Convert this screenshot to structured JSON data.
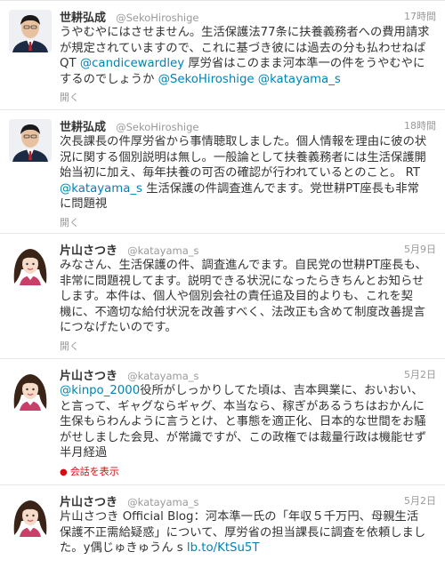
{
  "tweets": [
    {
      "name": "世耕弘成",
      "handle": "@SekoHiroshige",
      "time": "17時間",
      "lines": [
        "うやむやにはさせません。生活保護法77条に扶養義務者への費用請求",
        "が規定されていますので、これに基づき彼には過去の分も払わせねば"
      ],
      "line3": {
        "pre": "QT ",
        "mention1": "@candicewardley",
        "mid": " 厚労省はこのまま河本準一の件をうやむやに"
      },
      "line4": {
        "pre": "するのでしょうか ",
        "mention1": "@SekoHiroshige",
        "sep": " ",
        "mention2": "@katayama_s"
      },
      "action": "開く"
    },
    {
      "name": "世耕弘成",
      "handle": "@SekoHiroshige",
      "time": "18時間",
      "lines": [
        "次長課長の件厚労省から事情聴取しました。個人情報を理由に彼の状",
        "況に関する個別説明は無し。一般論として扶養義務者には生活保護開",
        "始当初に加え、毎年扶養の可否の確認が行われているとのこと。 RT"
      ],
      "line4": {
        "mention1": "@katayama_s",
        "post": " 生活保護の件調査進んでます。党世耕PT座長も非常"
      },
      "line5": "に問題視",
      "action": "開く"
    },
    {
      "name": "片山さつき",
      "handle": "@katayama_s",
      "time": "5月9日",
      "lines": [
        "みなさん、生活保護の件、調査進んでます。自民党の世耕PT座長も、",
        "非常に問題視してます。説明できる状況になったらきちんとお知らせ",
        "します。本件は、個人や個別会社の責任追及目的よりも、これを契",
        "機に、不適切な給付状況を改善すべく、法改正も含めて制度改善提言",
        "につなげたいのです。"
      ],
      "action": "開く"
    },
    {
      "name": "片山さつき",
      "handle": "@katayama_s",
      "time": "5月2日",
      "line1": {
        "mention1": "@kinpo_2000",
        "post": "役所がしっかりしてた頃は、吉本興業に、おいおい、"
      },
      "lines": [
        "と言って、ギャグならギャグ、本当なら、稼ぎがあるうちはおかんに",
        "生保もらわんように言うとけ、と事態を適正化、日本的な世間をお騒",
        "がせしました会見、が常識ですが、この政権では裁量行政は機能せず",
        "半月経過"
      ],
      "conversation": "会話を表示"
    },
    {
      "name": "片山さつき",
      "handle": "@katayama_s",
      "time": "5月2日",
      "lines": [
        "片山さつき Official Blog：河本準一氏の「年収５千万円、母親生活",
        "保護不正需給疑惑」について、厚労省の担当課長に調査を依頼しまし"
      ],
      "line3": {
        "pre": "た。y偶じゅきゅうん s ",
        "link": "lb.to/KtSu5T"
      }
    }
  ],
  "colors": {
    "link": "#0084b4",
    "name": "#333333",
    "meta": "#999999",
    "conversation": "#d40d12"
  },
  "icons": {
    "conversation": "conversation-dot-icon"
  }
}
